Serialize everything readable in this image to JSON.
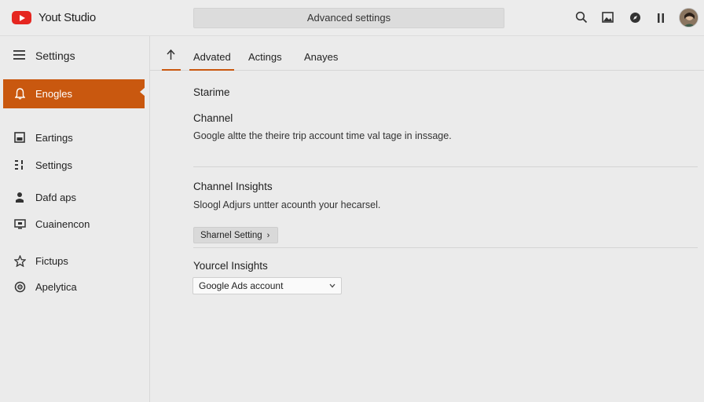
{
  "app": {
    "title": "Yout Studio"
  },
  "search": {
    "value": "Advanced settings"
  },
  "sidebar": {
    "header": "Settings",
    "items": [
      {
        "label": "Enogles",
        "icon": "bell-icon",
        "active": true
      },
      {
        "label": "Eartings",
        "icon": "earnings-icon"
      },
      {
        "label": "Settings",
        "icon": "settings-grid-icon"
      },
      {
        "label": "Dafd aps",
        "icon": "person-icon"
      },
      {
        "label": "Cuainencon",
        "icon": "monitor-icon"
      },
      {
        "label": "Fictups",
        "icon": "star-icon"
      },
      {
        "label": "Apelytica",
        "icon": "target-icon"
      }
    ]
  },
  "tabs": [
    {
      "label": "Advated",
      "active": true
    },
    {
      "label": "Actings"
    },
    {
      "label": "Anayes"
    }
  ],
  "main": {
    "section_label": "Starime",
    "channel": {
      "title": "Channel",
      "desc": "Google altte the theire trip account time val tage in inssage."
    },
    "channel_insights": {
      "title": "Channel Insights",
      "desc": "Sloogl Adjurs untter acounth your hecarsel.",
      "button_label": "Sharnel Setting"
    },
    "your_insights": {
      "title": "Yourcel Insights",
      "select_value": "Google Ads account"
    }
  },
  "colors": {
    "accent": "#c9580f",
    "brand_red": "#e52620"
  }
}
